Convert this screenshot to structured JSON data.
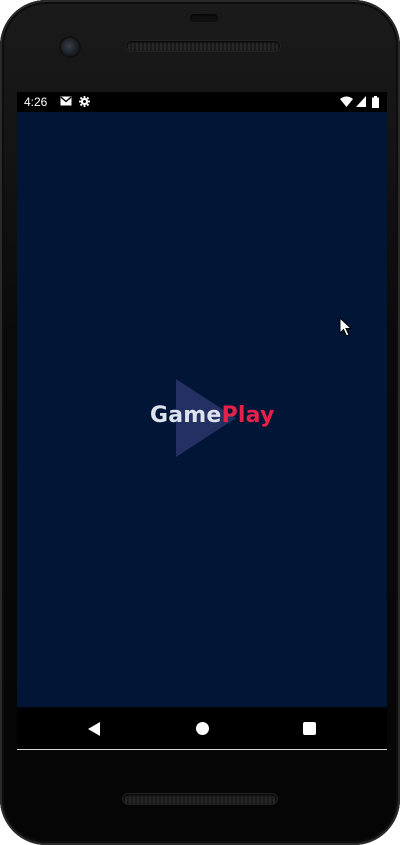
{
  "status_bar": {
    "time": "4:26",
    "left_icons": [
      "gmail-icon",
      "settings-gear-icon"
    ],
    "right_icons": [
      "wifi-icon",
      "cell-signal-icon",
      "battery-icon"
    ]
  },
  "app": {
    "background_color": "#011636",
    "logo": {
      "part1": "Game",
      "part2": "Play",
      "part1_color": "#dde3ee",
      "part2_color": "#e5214a",
      "mark_icon": "play-triangle-icon"
    }
  },
  "nav_bar": {
    "buttons": [
      "back-button",
      "home-button",
      "recents-button"
    ]
  }
}
